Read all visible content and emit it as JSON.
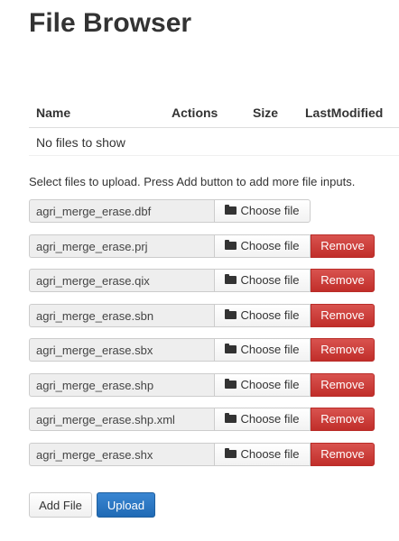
{
  "page": {
    "title": "File Browser"
  },
  "table": {
    "headers": {
      "name": "Name",
      "actions": "Actions",
      "size": "Size",
      "last_modified": "LastModified"
    },
    "empty_message": "No files to show"
  },
  "upload": {
    "hint": "Select files to upload. Press Add button to add more file inputs.",
    "choose_label": "Choose file",
    "remove_label": "Remove",
    "files": [
      "agri_merge_erase.dbf",
      "agri_merge_erase.prj",
      "agri_merge_erase.qix",
      "agri_merge_erase.sbn",
      "agri_merge_erase.sbx",
      "agri_merge_erase.shp",
      "agri_merge_erase.shp.xml",
      "agri_merge_erase.shx"
    ]
  },
  "actions": {
    "add_file_label": "Add File",
    "upload_label": "Upload"
  },
  "colors": {
    "remove": "#d9534f",
    "upload": "#2a78c4"
  }
}
